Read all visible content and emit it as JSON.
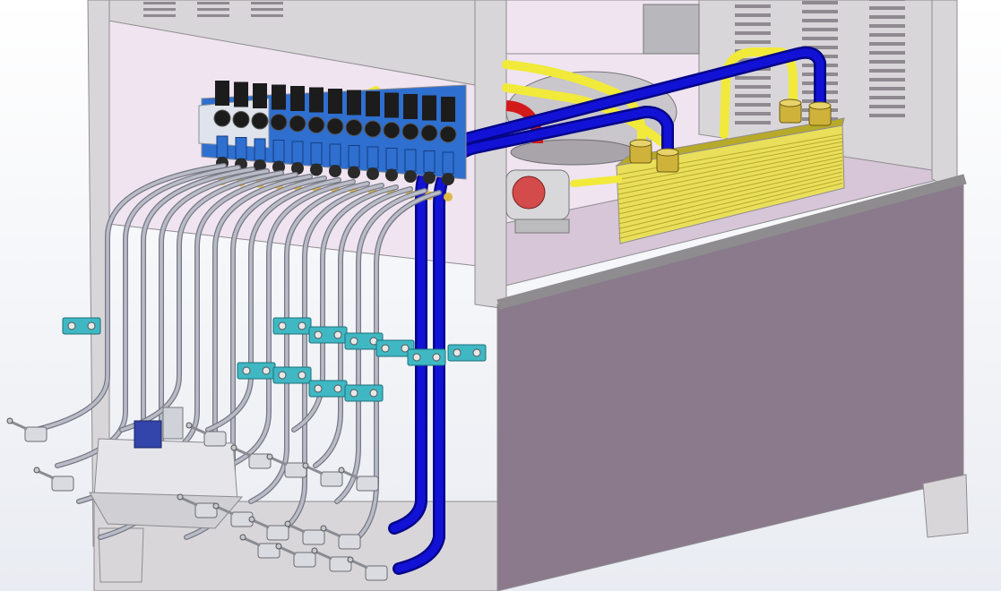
{
  "scene": {
    "subject": "hydraulic-power-unit-cad-render",
    "colors": {
      "background_top": "#ffffff",
      "background_bottom": "#e9ecf2",
      "cabinet": "#8a7a8c",
      "cabinet_dark": "#6f6172",
      "frame": "#d9d6d9",
      "frame_edge": "#8f8c90",
      "interior": "#efe4f0",
      "interior_shadow": "#d7c6d8",
      "pipe_blue": "#1212d6",
      "pipe_blue_dark": "#05058a",
      "pipe_yellow": "#f1ea3a",
      "pipe_steel": "#b9bcc6",
      "manifold_blue": "#2e6fd0",
      "valve_black": "#1c1c1c",
      "clamp_cyan": "#3fb8c4",
      "heat_exchanger": "#e9df5a",
      "heat_exchanger_dark": "#b7aa2a",
      "fitting_brass": "#cfb23a",
      "red_pipe": "#d21a1a",
      "filter_red": "#d44b4b"
    },
    "icons": [
      "hydraulic-valve-icon",
      "heat-exchanger-icon",
      "pipe-clamp-icon",
      "pressure-gauge-icon",
      "ball-valve-icon"
    ]
  }
}
